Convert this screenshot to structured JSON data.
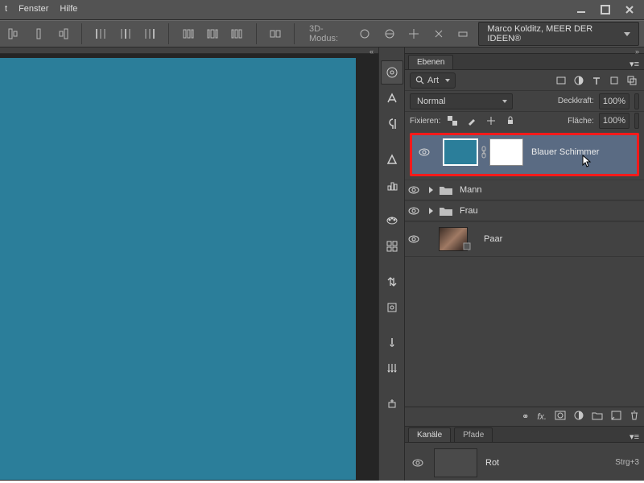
{
  "menu": {
    "item0": "t",
    "item1": "Fenster",
    "item2": "Hilfe"
  },
  "options": {
    "mode3d_label": "3D-Modus:",
    "badge": "Marco Kolditz, MEER DER IDEEN®"
  },
  "layers_panel": {
    "tab": "Ebenen",
    "search_label": "Art",
    "blend_mode": "Normal",
    "opacity_label": "Deckkraft:",
    "opacity_value": "100%",
    "lock_label": "Fixieren:",
    "fill_label": "Fläche:",
    "fill_value": "100%",
    "layers": {
      "selected": {
        "name": "Blauer Schimmer"
      },
      "group1": {
        "name": "Mann"
      },
      "group2": {
        "name": "Frau"
      },
      "layer_pair": {
        "name": "Paar"
      }
    },
    "footer_fx": "fx."
  },
  "channels_panel": {
    "tab1": "Kanäle",
    "tab2": "Pfade",
    "ch_red": {
      "name": "Rot",
      "shortcut": "Strg+3"
    }
  }
}
